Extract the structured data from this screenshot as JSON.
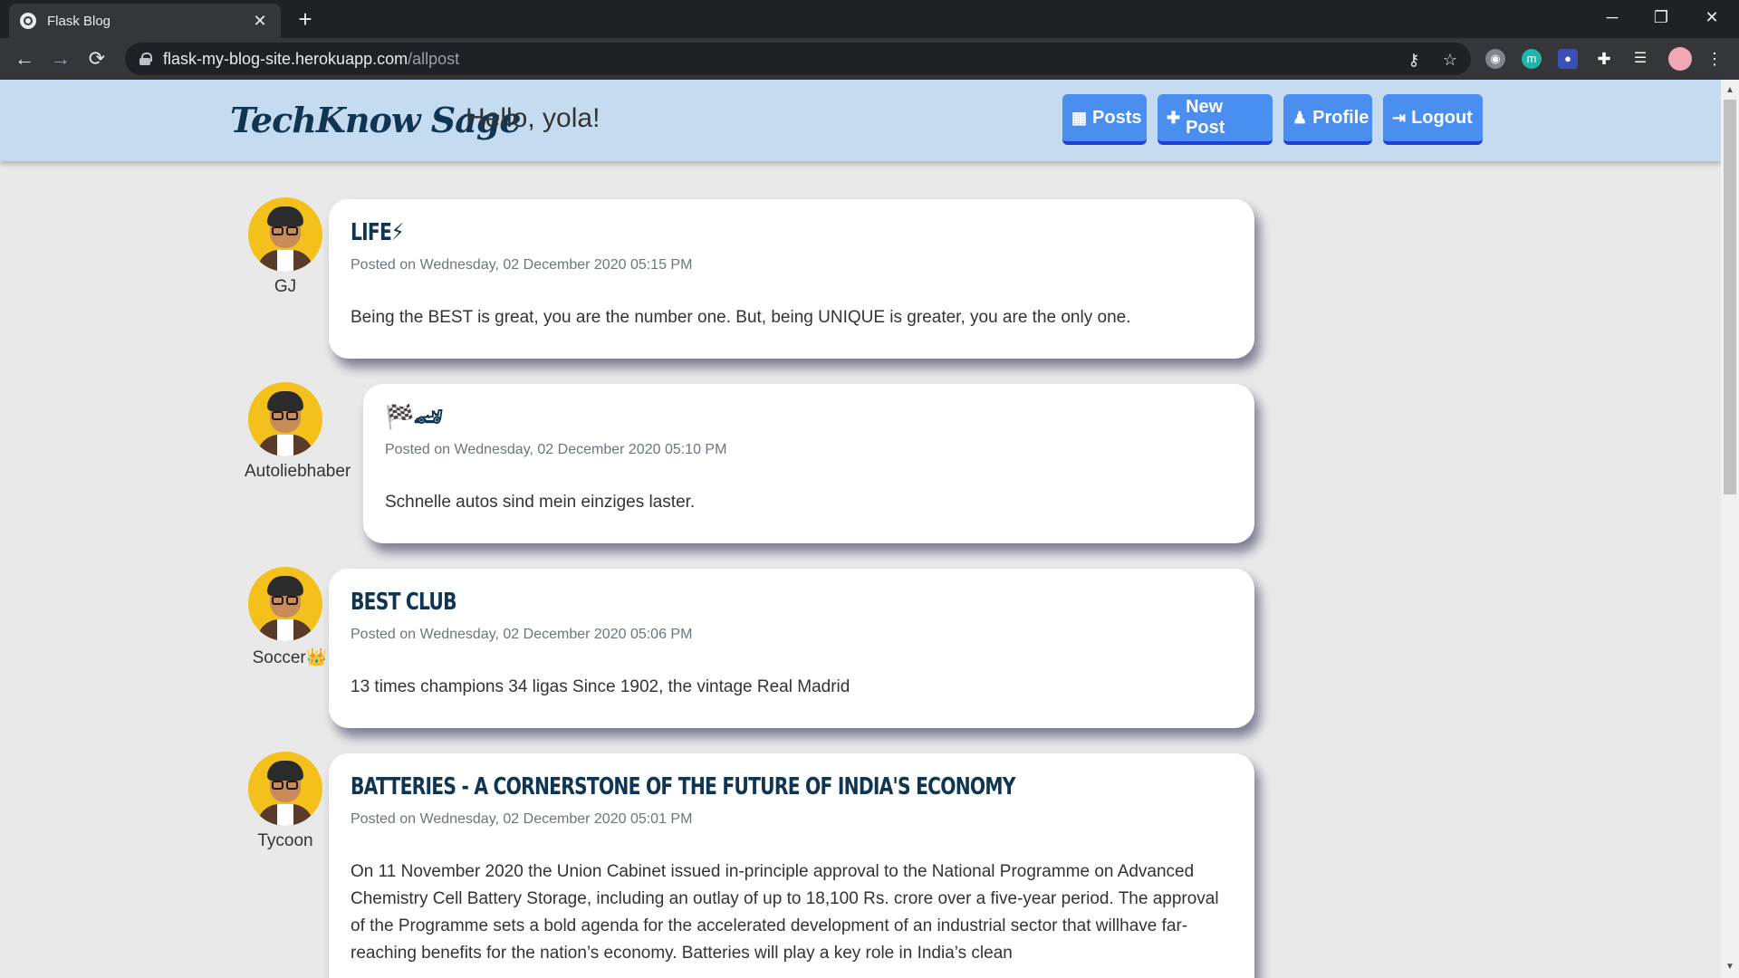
{
  "browser": {
    "tab_title": "Flask Blog",
    "tab_close": "✕",
    "new_tab": "+",
    "url_host": "flask-my-blog-site.herokuapp.com",
    "url_path": "/allpost",
    "window_controls": {
      "minimize": "─",
      "restore": "❐",
      "close": "✕"
    },
    "nav": {
      "back": "←",
      "forward": "→",
      "reload": "⟳"
    },
    "toolbar_icons": [
      "key-icon",
      "star-icon",
      "camera-icon",
      "extension-m-icon",
      "extension-card-icon",
      "puzzle-icon",
      "media-icon",
      "profile-avatar-icon",
      "menu-icon"
    ]
  },
  "site": {
    "brand": "TechKnow Sage",
    "greeting": "Hello, yola!",
    "nav": [
      {
        "label": "Posts",
        "icon": "grid-icon"
      },
      {
        "label": "New Post",
        "icon": "plus-icon"
      },
      {
        "label": "Profile",
        "icon": "user-icon"
      },
      {
        "label": "Logout",
        "icon": "logout-icon"
      }
    ]
  },
  "posts": [
    {
      "author": "GJ",
      "title": "LIFE⚡",
      "meta": "Posted on Wednesday, 02 December 2020 05:15 PM",
      "content": "Being the BEST is great, you are the number one. But, being UNIQUE is greater, you are the only one."
    },
    {
      "author": "Autoliebhaber",
      "title": "🏁🏎",
      "meta": "Posted on Wednesday, 02 December 2020 05:10 PM",
      "content": "Schnelle autos sind mein einziges laster."
    },
    {
      "author": "Soccer👑",
      "title": "BEST CLUB",
      "meta": "Posted on Wednesday, 02 December 2020 05:06 PM",
      "content": "13 times champions 34 ligas Since 1902, the vintage Real Madrid"
    },
    {
      "author": "Tycoon",
      "title": "BATTERIES - A CORNERSTONE OF THE FUTURE OF INDIA'S ECONOMY",
      "meta": "Posted on Wednesday, 02 December 2020 05:01 PM",
      "content": "On 11 November 2020 the Union Cabinet issued in-principle approval to the National Programme on Advanced Chemistry Cell Battery Storage, including an outlay of up to 18,100 Rs. crore over a five-year period. The approval of the Programme sets a bold agenda for the accelerated development of an industrial sector that willhave far-reaching benefits for the nation’s economy. Batteries will play a key role in India’s clean"
    }
  ],
  "colors": {
    "header_bg": "#c5dcf0",
    "brand": "#0f3553",
    "button": "#4a8ef0",
    "button_border": "#1c40e0",
    "avatar_bg": "#f4c01c"
  }
}
